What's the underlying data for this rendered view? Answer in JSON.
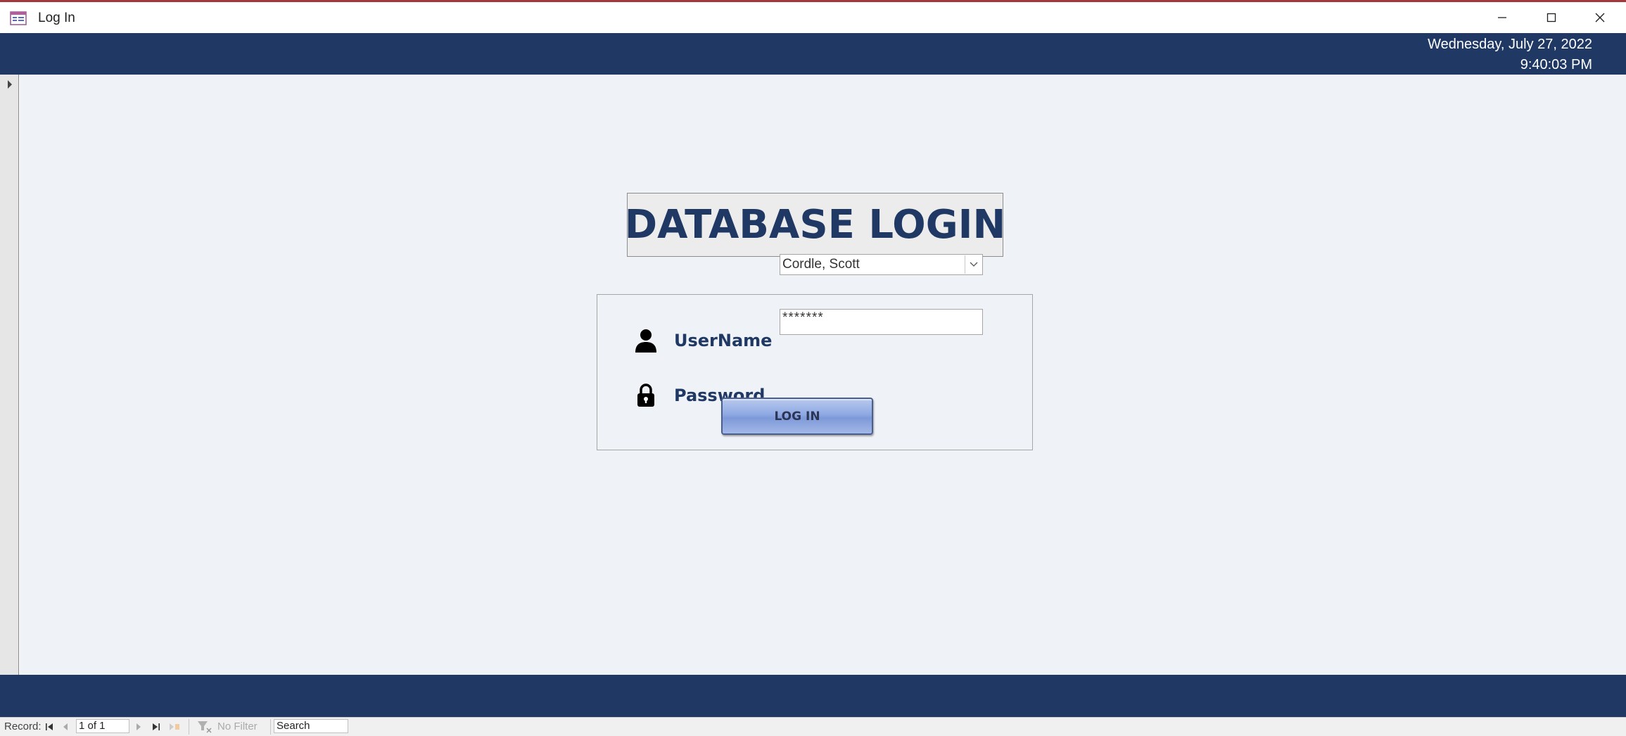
{
  "window": {
    "title": "Log In",
    "icon": "access-form-icon",
    "controls": [
      "minimize-icon",
      "maximize-icon",
      "close-icon"
    ]
  },
  "header": {
    "date": "Wednesday, July 27, 2022",
    "time": "9:40:03 PM"
  },
  "form": {
    "heading": "DATABASE LOGIN",
    "username": {
      "label": "UserName",
      "icon": "user-icon",
      "value": "Cordle, Scott"
    },
    "password": {
      "label": "Password",
      "icon": "lock-icon",
      "value": "*******"
    },
    "login_button": "LOG IN"
  },
  "navbar": {
    "record_label": "Record:",
    "position": "1 of 1",
    "filter": "No Filter",
    "search": "Search"
  },
  "colors": {
    "band": "#203864",
    "body": "#eff2f7",
    "heading": "#203864",
    "button": "#8ea9e3"
  }
}
